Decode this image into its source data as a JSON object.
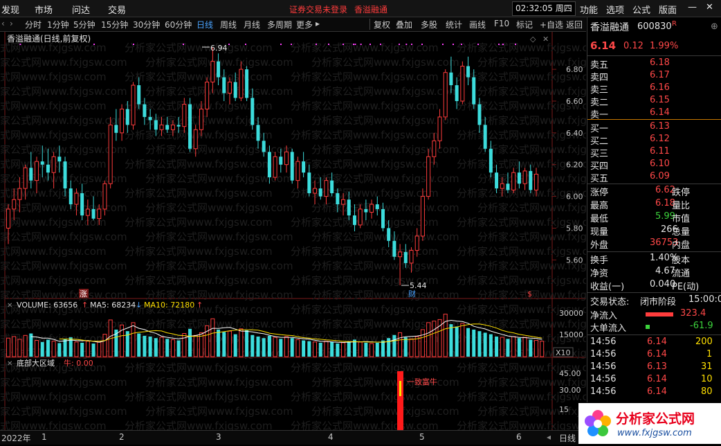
{
  "menu": {
    "items": [
      "发现",
      "市场",
      "问达",
      "交易"
    ],
    "alert": "证券交易未登录",
    "stock_tag": "香溢融通",
    "clock": "02:32:05 周四",
    "right_items": [
      "功能",
      "选项",
      "公式",
      "版面"
    ]
  },
  "toolbar": {
    "periods": [
      "分时",
      "1分钟",
      "5分钟",
      "15分钟",
      "30分钟",
      "60分钟",
      "日线",
      "周线",
      "月线",
      "多周期",
      "更多"
    ],
    "active_period": "日线",
    "tools": [
      "复权",
      "叠加",
      "多股",
      "统计",
      "画线",
      "F10",
      "标记",
      "+自选",
      "返回"
    ]
  },
  "chart_header": {
    "title": "香溢融通(日线,前复权)",
    "watermark": "分析家公式网www.fxjgsw.com"
  },
  "price_axis": {
    "labels": [
      "6.80",
      "6.60",
      "6.40",
      "6.20",
      "6.00",
      "5.80",
      "5.60"
    ]
  },
  "annotations": {
    "high": "6.94",
    "low": "5.44",
    "zhang": "涨",
    "cai": "财",
    "dollar": "$"
  },
  "volume_header": {
    "volume": "VOLUME: 63656",
    "ma5": "MA5: 68234",
    "ma10": "MA10: 72180",
    "axis": [
      "30000",
      "15000"
    ],
    "unit": "X10"
  },
  "indicator": {
    "name": "底部大区域",
    "niu": "牛: 0.00",
    "signal": "一致富牛",
    "axis": [
      "45.00",
      "30.00",
      "15"
    ]
  },
  "timeline": {
    "labels": [
      "2022年",
      "1",
      "2",
      "3",
      "4",
      "5",
      "6"
    ],
    "right": "日线"
  },
  "quote": {
    "name": "香溢融通",
    "code": "600830",
    "r_mark": "R",
    "price": "6.14",
    "change": "0.12",
    "pct": "1.99%",
    "asks": [
      {
        "label": "卖五",
        "price": "6.18"
      },
      {
        "label": "卖四",
        "price": "6.17"
      },
      {
        "label": "卖三",
        "price": "6.16"
      },
      {
        "label": "卖二",
        "price": "6.15"
      },
      {
        "label": "卖一",
        "price": "6.14"
      }
    ],
    "bids": [
      {
        "label": "买一",
        "price": "6.13"
      },
      {
        "label": "买二",
        "price": "6.12"
      },
      {
        "label": "买三",
        "price": "6.11"
      },
      {
        "label": "买四",
        "price": "6.10"
      },
      {
        "label": "买五",
        "price": "6.09"
      }
    ],
    "stats": [
      {
        "label": "涨停",
        "value": "6.62",
        "tail": "跌停",
        "cls": "red"
      },
      {
        "label": "最高",
        "value": "6.18",
        "tail": "量比",
        "cls": "red"
      },
      {
        "label": "最低",
        "value": "5.99",
        "tail": "市值",
        "cls": "green"
      },
      {
        "label": "现量",
        "value": "266",
        "tail": "总量",
        "cls": "white"
      },
      {
        "label": "外盘",
        "value": "36753",
        "tail": "内盘",
        "cls": "red"
      }
    ],
    "stats2": [
      {
        "label": "换手",
        "value": "1.40%",
        "tail": "股本"
      },
      {
        "label": "净资",
        "value": "4.67",
        "tail": "流通"
      },
      {
        "label": "收益(一)",
        "value": "0.040",
        "tail": "PE(动)"
      }
    ],
    "status_label": "交易状态:",
    "status_value": "闭市阶段",
    "status_time": "15:00:0",
    "inflow": {
      "label": "净流入",
      "value": "323.4"
    },
    "big_inflow": {
      "label": "大单流入",
      "value": "-61.9"
    },
    "ticks": [
      {
        "time": "14:56",
        "price": "6.14",
        "vol": "200"
      },
      {
        "time": "14:56",
        "price": "6.14",
        "vol": "1"
      },
      {
        "time": "14:56",
        "price": "6.13",
        "vol": "31"
      },
      {
        "time": "14:56",
        "price": "6.14",
        "vol": "10"
      },
      {
        "time": "14:56",
        "price": "6.14",
        "vol": "80"
      }
    ]
  },
  "logo": {
    "text": "分析家公式网",
    "url": "www.fxjgsw.com"
  },
  "chart_data": {
    "type": "candlestick",
    "title": "香溢融通(日线,前复权)",
    "ylim": [
      5.44,
      6.94
    ],
    "candles": [
      [
        5.8,
        5.95,
        5.7,
        5.92
      ],
      [
        5.92,
        6.05,
        5.85,
        5.98
      ],
      [
        5.98,
        6.12,
        5.9,
        6.05
      ],
      [
        6.05,
        6.2,
        5.98,
        6.18
      ],
      [
        6.18,
        6.28,
        6.05,
        6.1
      ],
      [
        6.1,
        6.25,
        6.02,
        6.22
      ],
      [
        6.22,
        6.32,
        6.12,
        6.2
      ],
      [
        6.2,
        6.3,
        6.1,
        6.15
      ],
      [
        6.15,
        6.28,
        6.05,
        6.25
      ],
      [
        6.25,
        6.32,
        6.15,
        6.22
      ],
      [
        6.22,
        6.25,
        6.0,
        6.05
      ],
      [
        6.05,
        6.1,
        5.92,
        5.95
      ],
      [
        5.95,
        6.05,
        5.88,
        6.02
      ],
      [
        6.02,
        6.08,
        5.85,
        5.88
      ],
      [
        5.88,
        5.98,
        5.82,
        5.92
      ],
      [
        5.92,
        6.0,
        5.85,
        5.86
      ],
      [
        5.86,
        5.95,
        5.82,
        5.92
      ],
      [
        5.92,
        6.1,
        5.88,
        6.08
      ],
      [
        6.08,
        6.5,
        6.05,
        6.45
      ],
      [
        6.45,
        6.55,
        6.35,
        6.4
      ],
      [
        6.4,
        6.58,
        6.35,
        6.55
      ],
      [
        6.55,
        6.6,
        6.4,
        6.45
      ],
      [
        6.45,
        6.72,
        6.42,
        6.7
      ],
      [
        6.7,
        6.75,
        6.55,
        6.58
      ],
      [
        6.58,
        6.62,
        6.45,
        6.5
      ],
      [
        6.5,
        6.55,
        6.42,
        6.48
      ],
      [
        6.48,
        6.52,
        6.38,
        6.42
      ],
      [
        6.42,
        6.5,
        6.38,
        6.45
      ],
      [
        6.45,
        6.5,
        6.4,
        6.42
      ],
      [
        6.42,
        6.48,
        6.38,
        6.45
      ],
      [
        6.45,
        6.5,
        6.4,
        6.44
      ],
      [
        6.44,
        6.62,
        6.4,
        6.58
      ],
      [
        6.58,
        6.62,
        6.28,
        6.3
      ],
      [
        6.3,
        6.45,
        6.25,
        6.42
      ],
      [
        6.42,
        6.6,
        6.38,
        6.55
      ],
      [
        6.55,
        6.75,
        6.5,
        6.72
      ],
      [
        6.72,
        6.94,
        6.65,
        6.85
      ],
      [
        6.85,
        6.9,
        6.7,
        6.75
      ],
      [
        6.75,
        6.8,
        6.6,
        6.65
      ],
      [
        6.65,
        6.75,
        6.58,
        6.72
      ],
      [
        6.72,
        6.78,
        6.6,
        6.62
      ],
      [
        6.62,
        6.85,
        6.6,
        6.8
      ],
      [
        6.8,
        6.82,
        6.6,
        6.62
      ],
      [
        6.62,
        6.68,
        6.42,
        6.45
      ],
      [
        6.45,
        6.5,
        6.3,
        6.35
      ],
      [
        6.35,
        6.4,
        6.25,
        6.28
      ],
      [
        6.28,
        6.32,
        6.08,
        6.12
      ],
      [
        6.12,
        6.28,
        6.1,
        6.25
      ],
      [
        6.25,
        6.3,
        6.15,
        6.2
      ],
      [
        6.2,
        6.32,
        6.15,
        6.28
      ],
      [
        6.28,
        6.3,
        6.08,
        6.1
      ],
      [
        6.1,
        6.25,
        6.05,
        6.22
      ],
      [
        6.22,
        6.28,
        6.12,
        6.15
      ],
      [
        6.15,
        6.2,
        6.0,
        6.02
      ],
      [
        6.02,
        6.1,
        5.95,
        6.05
      ],
      [
        6.05,
        6.12,
        5.98,
        6.0
      ],
      [
        6.0,
        6.12,
        5.95,
        6.1
      ],
      [
        6.1,
        6.15,
        6.0,
        6.02
      ],
      [
        6.02,
        6.05,
        5.9,
        5.95
      ],
      [
        5.95,
        6.02,
        5.88,
        5.98
      ],
      [
        5.98,
        6.03,
        5.85,
        5.88
      ],
      [
        5.88,
        5.95,
        5.78,
        5.82
      ],
      [
        5.82,
        5.95,
        5.8,
        5.92
      ],
      [
        5.92,
        5.98,
        5.85,
        5.9
      ],
      [
        5.9,
        5.98,
        5.86,
        5.95
      ],
      [
        5.95,
        6.0,
        5.88,
        5.92
      ],
      [
        5.92,
        5.96,
        5.78,
        5.8
      ],
      [
        5.8,
        5.85,
        5.68,
        5.72
      ],
      [
        5.72,
        5.78,
        5.6,
        5.62
      ],
      [
        5.62,
        5.7,
        5.44,
        5.65
      ],
      [
        5.65,
        5.7,
        5.55,
        5.58
      ],
      [
        5.58,
        5.68,
        5.52,
        5.66
      ],
      [
        5.66,
        5.8,
        5.62,
        5.75
      ],
      [
        5.75,
        6.05,
        5.72,
        6.0
      ],
      [
        6.0,
        6.3,
        5.98,
        6.25
      ],
      [
        6.25,
        6.4,
        6.2,
        6.35
      ],
      [
        6.35,
        6.55,
        6.3,
        6.5
      ],
      [
        6.5,
        6.8,
        6.48,
        6.78
      ],
      [
        6.78,
        6.88,
        6.65,
        6.7
      ],
      [
        6.7,
        6.75,
        6.55,
        6.6
      ],
      [
        6.6,
        6.85,
        6.58,
        6.82
      ],
      [
        6.82,
        6.88,
        6.7,
        6.75
      ],
      [
        6.75,
        6.8,
        6.55,
        6.58
      ],
      [
        6.58,
        6.62,
        6.4,
        6.45
      ],
      [
        6.45,
        6.5,
        6.28,
        6.3
      ],
      [
        6.3,
        6.35,
        6.12,
        6.15
      ],
      [
        6.15,
        6.2,
        6.02,
        6.05
      ],
      [
        6.05,
        6.12,
        6.0,
        6.08
      ],
      [
        6.08,
        6.15,
        6.02,
        6.04
      ],
      [
        6.04,
        6.18,
        6.02,
        6.15
      ],
      [
        6.15,
        6.22,
        6.05,
        6.08
      ],
      [
        6.08,
        6.18,
        6.04,
        6.16
      ],
      [
        6.16,
        6.2,
        6.02,
        6.04
      ],
      [
        6.04,
        6.18,
        6.0,
        6.14
      ]
    ],
    "volume": [
      48,
      52,
      45,
      55,
      60,
      42,
      38,
      44,
      40,
      35,
      46,
      50,
      38,
      36,
      40,
      34,
      38,
      58,
      95,
      70,
      82,
      66,
      88,
      60,
      54,
      52,
      48,
      50,
      46,
      44,
      42,
      60,
      72,
      55,
      62,
      80,
      98,
      70,
      64,
      66,
      58,
      72,
      68,
      56,
      52,
      48,
      54,
      50,
      46,
      52,
      48,
      44,
      42,
      40,
      38,
      36,
      40,
      38,
      34,
      36,
      40,
      44,
      38,
      36,
      34,
      36,
      42,
      48,
      56,
      62,
      50,
      46,
      52,
      70,
      88,
      92,
      96,
      110,
      84,
      78,
      86,
      74,
      70,
      66,
      62,
      58,
      52,
      50,
      46,
      52,
      48,
      50,
      44,
      42,
      40
    ]
  }
}
